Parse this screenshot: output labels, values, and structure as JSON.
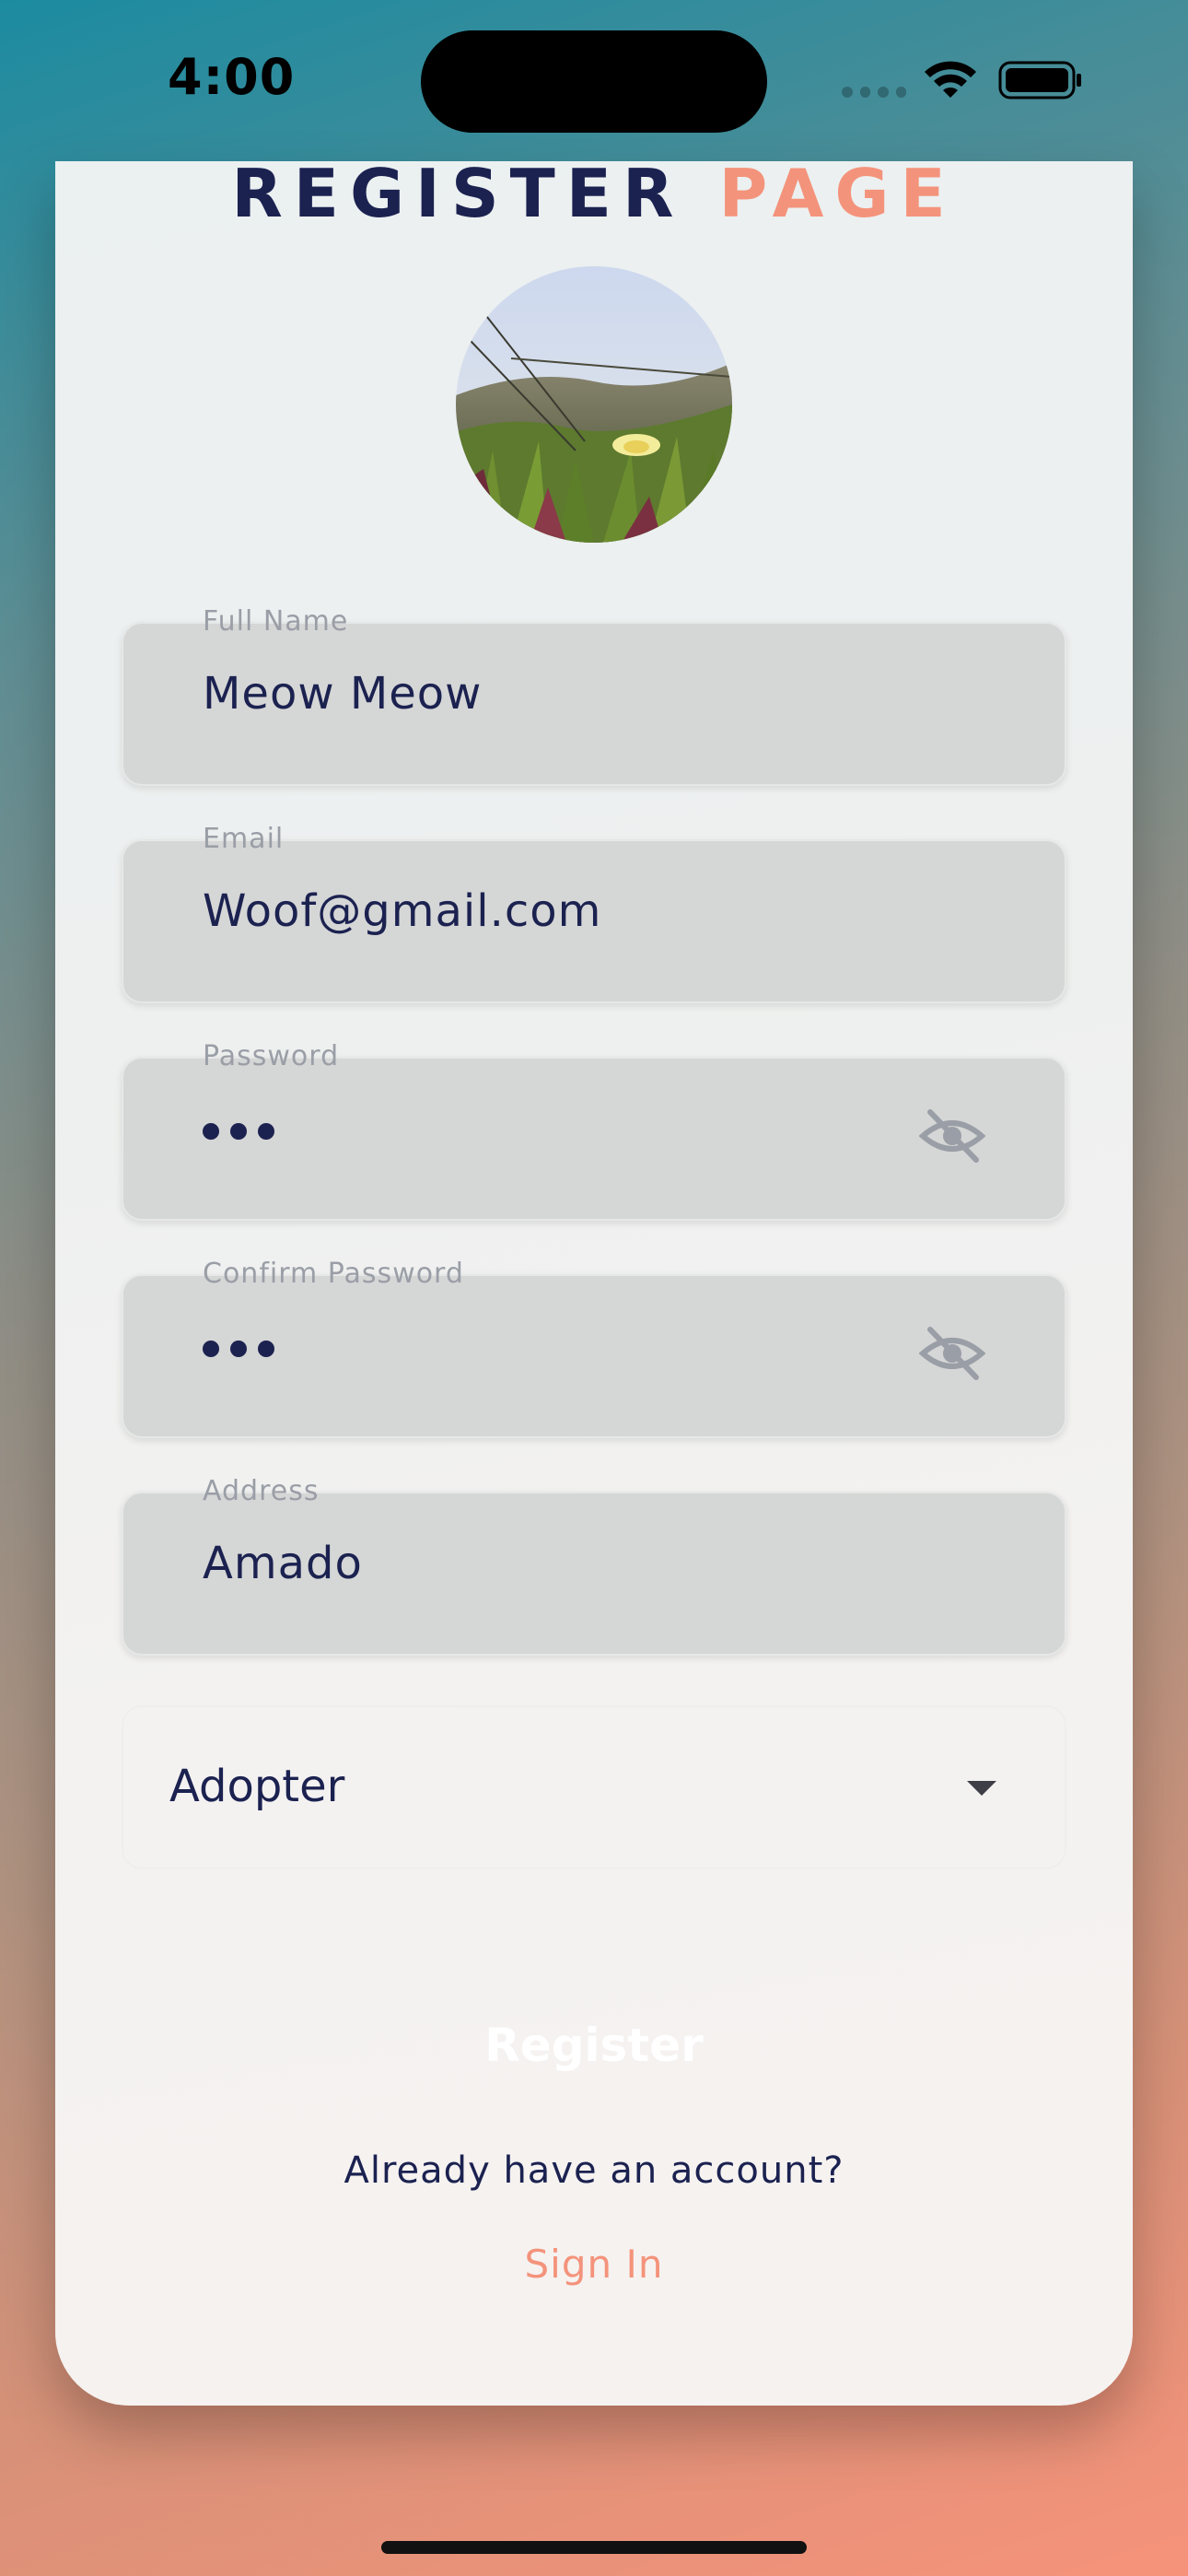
{
  "status_bar": {
    "time": "4:00"
  },
  "header": {
    "title_part1": "REGISTER",
    "title_part2": "PAGE"
  },
  "avatar": {
    "icon": "profile-photo-flower"
  },
  "form": {
    "full_name": {
      "label": "Full Name",
      "value": "Meow Meow"
    },
    "email": {
      "label": "Email",
      "value": "Woof@gmail.com"
    },
    "password": {
      "label": "Password",
      "masked_length": 3,
      "visibility_icon": "eye-off-icon"
    },
    "confirm_password": {
      "label": "Confirm Password",
      "masked_length": 3,
      "visibility_icon": "eye-off-icon"
    },
    "address": {
      "label": "Address",
      "value": "Amado"
    },
    "role": {
      "selected": "Adopter"
    }
  },
  "actions": {
    "register_label": "Register",
    "account_prompt": "Already have an account?",
    "signin_label": "Sign In"
  },
  "colors": {
    "navy": "#1b2250",
    "accent": "#f4937b",
    "field_bg": "#d5d6d6"
  }
}
